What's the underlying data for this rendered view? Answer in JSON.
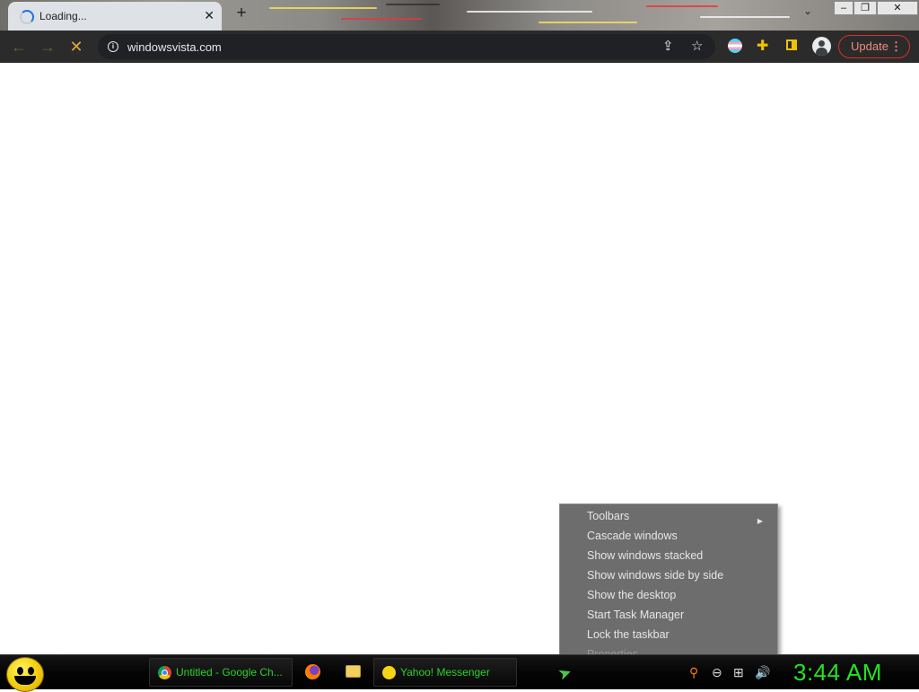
{
  "tab": {
    "title": "Loading..."
  },
  "omnibox": {
    "url": "windowsvista.com"
  },
  "toolbar": {
    "update_label": "Update",
    "update_menu": "⋮"
  },
  "context_menu": {
    "items": [
      {
        "label": "Toolbars",
        "has_submenu": true,
        "disabled": false
      },
      {
        "label": "Cascade windows",
        "disabled": false
      },
      {
        "label": "Show windows stacked",
        "disabled": false
      },
      {
        "label": "Show windows side by side",
        "disabled": false
      },
      {
        "label": "Show the desktop",
        "disabled": false
      },
      {
        "label": "Start Task Manager",
        "disabled": false
      },
      {
        "label": "Lock the taskbar",
        "disabled": false
      },
      {
        "label": "Properties",
        "disabled": true
      }
    ]
  },
  "taskbar": {
    "buttons": [
      {
        "label": "Untitled - Google Ch...",
        "icon": "chrome-icon"
      },
      {
        "label": "Yahoo! Messenger",
        "icon": "yahoo-messenger-icon"
      }
    ],
    "clock": "3:44 AM"
  },
  "colors": {
    "taskbar_text": "#2bd12b",
    "clock": "#22e322",
    "update_accent": "#d93025",
    "menu_bg": "#6d6d6d"
  }
}
